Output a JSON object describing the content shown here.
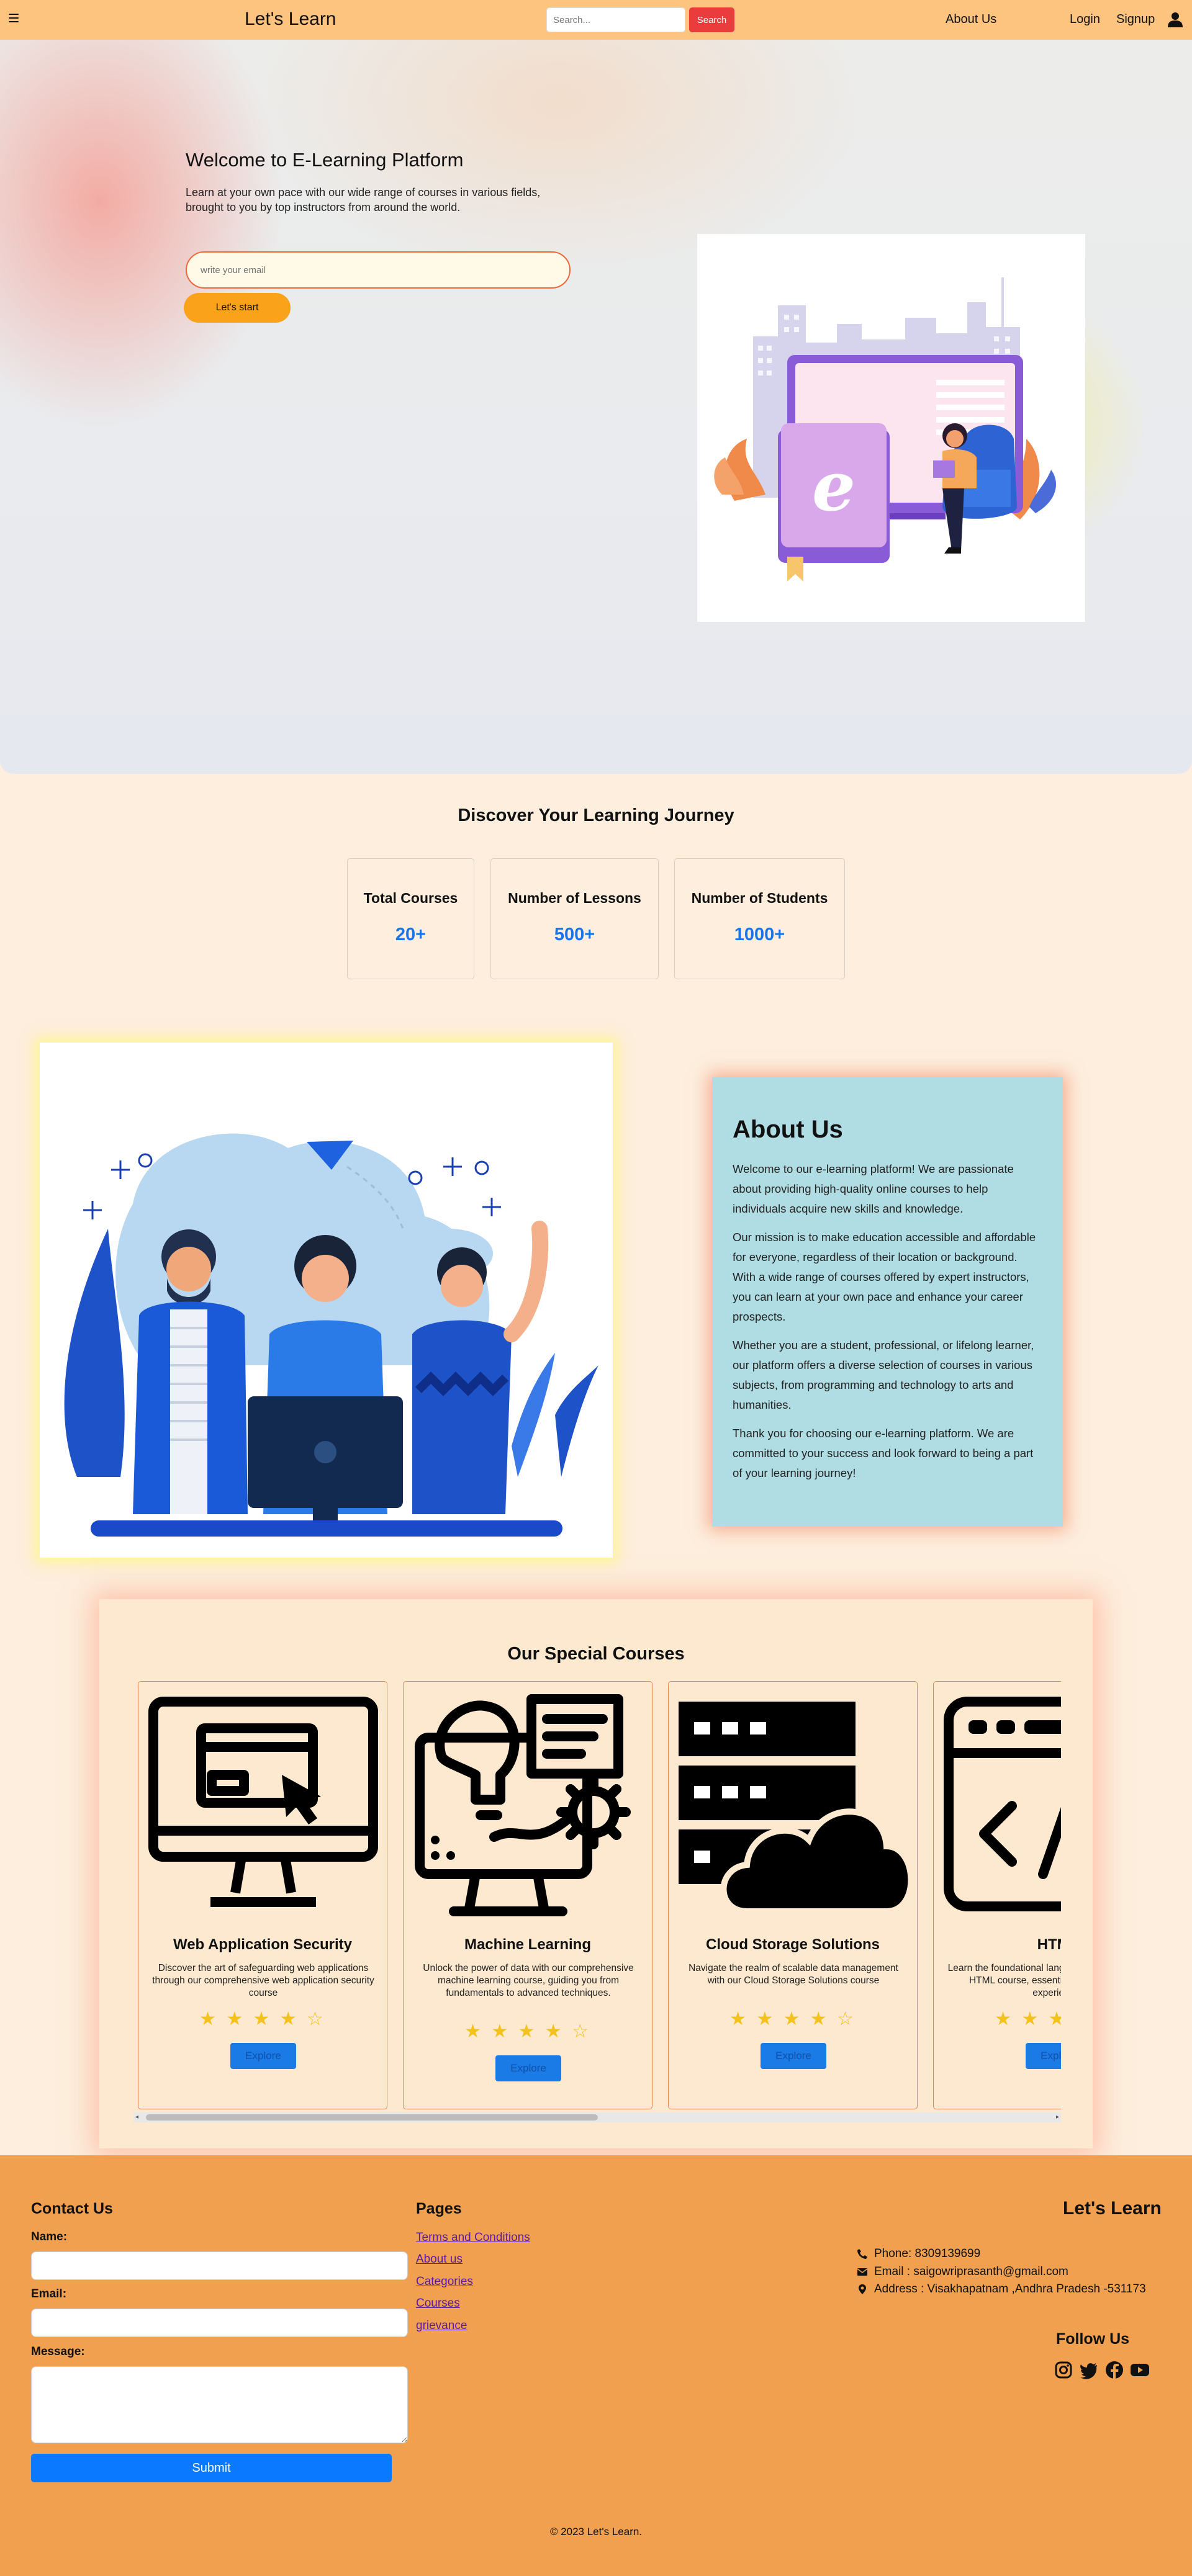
{
  "nav": {
    "brand": "Let's Learn",
    "search_placeholder": "Search...",
    "search_button": "Search",
    "links": [
      "About Us",
      "Login",
      "Signup"
    ]
  },
  "hero": {
    "title": "Welcome to E-Learning Platform",
    "text": "Learn at your own pace with our wide range of courses in various fields, brought to you by top instructors from around the world.",
    "email_placeholder": "write your email",
    "start_button": "Let's start"
  },
  "stats": {
    "title": "Discover Your Learning Journey",
    "items": [
      {
        "label": "Total Courses",
        "value": "20+"
      },
      {
        "label": "Number of Lessons",
        "value": "500+"
      },
      {
        "label": "Number of Students",
        "value": "1000+"
      }
    ]
  },
  "about": {
    "title": "About Us",
    "paragraphs": [
      "Welcome to our e-learning platform! We are passionate about providing high-quality online courses to help individuals acquire new skills and knowledge.",
      "Our mission is to make education accessible and affordable for everyone, regardless of their location or background. With a wide range of courses offered by expert instructors, you can learn at your own pace and enhance your career prospects.",
      "Whether you are a student, professional, or lifelong learner, our platform offers a diverse selection of courses in various subjects, from programming and technology to arts and humanities.",
      "Thank you for choosing our e-learning platform. We are committed to your success and look forward to being a part of your learning journey!"
    ]
  },
  "courses": {
    "title": "Our Special Courses",
    "explore_label": "Explore",
    "stars": "★ ★ ★ ★ ☆",
    "items": [
      {
        "name": "Web Application Security",
        "desc": "Discover the art of safeguarding web applications through our comprehensive web application security course",
        "icon": "computer-cursor-icon"
      },
      {
        "name": "Machine Learning",
        "desc": "Unlock the power of data with our comprehensive machine learning course, guiding you from fundamentals to advanced techniques.",
        "icon": "machine-learning-icon"
      },
      {
        "name": "Cloud Storage Solutions",
        "desc": "Navigate the realm of scalable data management with our Cloud Storage Solutions course",
        "icon": "cloud-server-icon"
      },
      {
        "name": "HTML",
        "desc": "Learn the foundational language of the web with our HTML course, essential for building online experiences",
        "icon": "code-window-icon"
      }
    ]
  },
  "footer": {
    "contact_title": "Contact Us",
    "name_label": "Name:",
    "email_label": "Email:",
    "message_label": "Message:",
    "submit_label": "Submit",
    "pages_title": "Pages",
    "pages": [
      "Terms and Conditions",
      "About us",
      "Categories",
      "Courses",
      "grievance"
    ],
    "brand": "Let's Learn",
    "phone": "Phone: 8309139699",
    "email": "Email : saigowriprasanth@gmail.com",
    "address": "Address : Visakhapatnam ,Andhra Pradesh -531173",
    "follow_title": "Follow Us",
    "copyright": "© 2023 Let's Learn."
  },
  "colors": {
    "navbar": "#fdc47f",
    "search_button": "#ea3c3c",
    "start_button": "#fba21b",
    "stat_value": "#1a73e8",
    "about_card": "#b0dde3",
    "footer": "#f0a04f",
    "submit": "#0a78ff",
    "stars": "#f4c21c"
  }
}
